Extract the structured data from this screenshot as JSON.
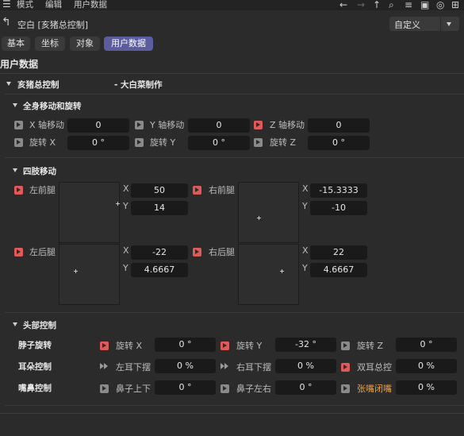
{
  "menu": {
    "items": [
      "模式",
      "编辑",
      "用户数据"
    ]
  },
  "title": {
    "object_name": "空白 [亥猪总控制]",
    "preset": "自定义"
  },
  "tabs": [
    {
      "label": "基本",
      "active": false
    },
    {
      "label": "坐标",
      "active": false
    },
    {
      "label": "对象",
      "active": false
    },
    {
      "label": "用户数据",
      "active": true
    }
  ],
  "section_title": "用户数据",
  "group_main": {
    "label": "亥猪总控制",
    "note": "- 大白菜制作"
  },
  "group_body": {
    "label": "全身移动和旋转",
    "rows": [
      [
        {
          "label": "X 轴移动",
          "value": "0",
          "key": "gray"
        },
        {
          "label": "Y 轴移动",
          "value": "0",
          "key": "gray"
        },
        {
          "label": "Z 轴移动",
          "value": "0",
          "key": "red"
        }
      ],
      [
        {
          "label": "旋转 X",
          "value": "0 °",
          "key": "gray"
        },
        {
          "label": "旋转 Y",
          "value": "0 °",
          "key": "gray"
        },
        {
          "label": "旋转 Z",
          "value": "0 °",
          "key": "gray"
        }
      ]
    ]
  },
  "group_limbs": {
    "label": "四肢移动",
    "pads": [
      {
        "label": "左前腿",
        "x": "50",
        "y": "14"
      },
      {
        "label": "右前腿",
        "x": "-15.3333",
        "y": "-10"
      },
      {
        "label": "左后腿",
        "x": "-22",
        "y": "4.6667"
      },
      {
        "label": "右后腿",
        "x": "22",
        "y": "4.6667"
      }
    ],
    "x_label": "X",
    "y_label": "Y"
  },
  "group_head": {
    "label": "头部控制",
    "rows": [
      {
        "label": "脖子旋转",
        "cells": [
          {
            "label": "旋转 X",
            "value": "0 °",
            "key": "red"
          },
          {
            "label": "旋转 Y",
            "value": "-32 °",
            "key": "red"
          },
          {
            "label": "旋转 Z",
            "value": "0 °",
            "key": "gray"
          }
        ]
      },
      {
        "label": "耳朵控制",
        "cells": [
          {
            "label": "左耳下摆",
            "value": "0 %",
            "key": "dbl"
          },
          {
            "label": "右耳下摆",
            "value": "0 %",
            "key": "dbl"
          },
          {
            "label": "双耳总控",
            "value": "0 %",
            "key": "red"
          }
        ]
      },
      {
        "label": "嘴鼻控制",
        "cells": [
          {
            "label": "鼻子上下",
            "value": "0 °",
            "key": "gray"
          },
          {
            "label": "鼻子左右",
            "value": "0 °",
            "key": "gray"
          },
          {
            "label": "张嘴闭嘴",
            "value": "0 %",
            "key": "gray"
          }
        ]
      }
    ]
  },
  "colors": {
    "accent": "#5b5d9f",
    "key_red": "#e05a5a",
    "highlight_label": "#f0a040"
  }
}
